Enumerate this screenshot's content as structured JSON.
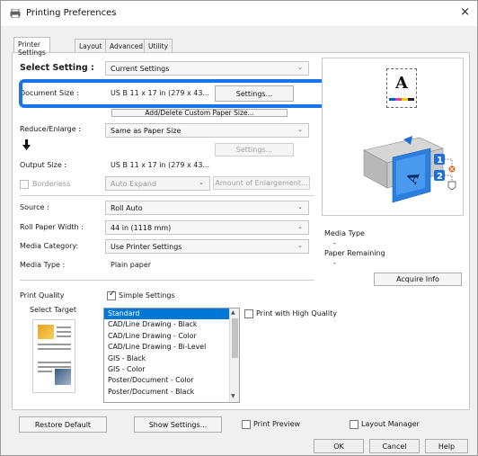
{
  "window": {
    "title": "Printing Preferences",
    "close_glyph": "×"
  },
  "tabs": [
    {
      "label": "Printer Settings",
      "active": true
    },
    {
      "label": "Layout",
      "active": false
    },
    {
      "label": "Advanced",
      "active": false
    },
    {
      "label": "Utility",
      "active": false
    }
  ],
  "select_setting": {
    "label": "Select Setting :",
    "value": "Current Settings"
  },
  "document_size": {
    "label": "Document Size :",
    "value": "US B 11 x 17 in (279 x 43...",
    "settings_button": "Settings..."
  },
  "add_delete_button": "Add/Delete Custom Paper Size...",
  "reduce_enlarge": {
    "label": "Reduce/Enlarge :",
    "value": "Same as Paper Size",
    "settings_button": "Settings..."
  },
  "output_size": {
    "label": "Output Size :",
    "value": "US B 11 x 17 in (279 x 43..."
  },
  "borderless": {
    "label": "Borderless",
    "value": "Auto Expand",
    "amount_button": "Amount of Enlargement..."
  },
  "source": {
    "label": "Source :",
    "value": "Roll Auto"
  },
  "roll_paper_width": {
    "label": "Roll Paper Width :",
    "value": "44 in (1118 mm)"
  },
  "media_category": {
    "label": "Media Category:",
    "value": "Use Printer Settings"
  },
  "media_type": {
    "label": "Media Type :",
    "value": "Plain paper"
  },
  "printer_status": {
    "media_type_label": "Media Type",
    "media_type_value": "-",
    "paper_remaining_label": "Paper Remaining",
    "paper_remaining_value": "-",
    "acquire_button": "Acquire Info",
    "preview_letter": "A",
    "roll_1": "1",
    "roll_2": "2"
  },
  "print_quality": {
    "label": "Print Quality",
    "simple_settings": "Simple Settings",
    "simple_checked": true,
    "select_target": "Select Target",
    "high_quality": "Print with High Quality",
    "high_quality_checked": false,
    "targets": [
      "Standard",
      "CAD/Line Drawing - Black",
      "CAD/Line Drawing - Color",
      "CAD/Line Drawing - Bi-Level",
      "GIS - Black",
      "GIS - Color",
      "Poster/Document - Color",
      "Poster/Document - Black"
    ],
    "selected_index": 0
  },
  "bottom": {
    "restore_default": "Restore Default",
    "show_settings": "Show Settings...",
    "print_preview": "Print Preview",
    "layout_manager": "Layout Manager"
  },
  "footer": {
    "ok": "OK",
    "cancel": "Cancel",
    "help": "Help"
  },
  "colors": {
    "accent": "#1a73e8",
    "selection": "#0078d7",
    "printer_blue": "#1e6fd9"
  }
}
